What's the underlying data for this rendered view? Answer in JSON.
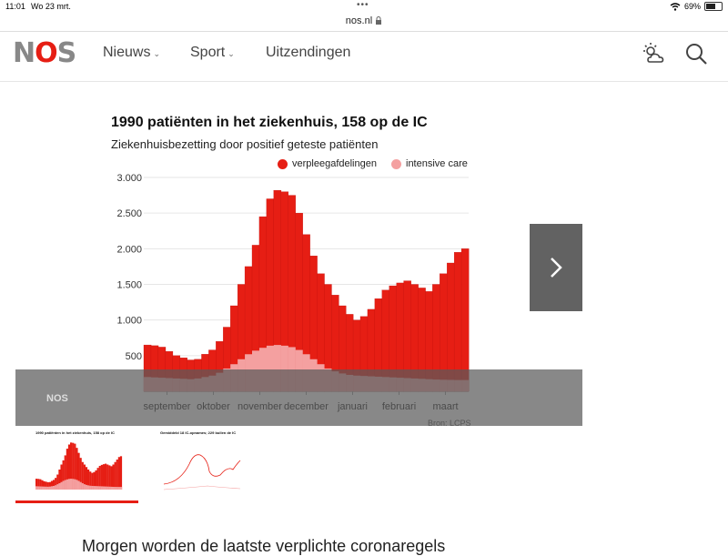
{
  "status_bar": {
    "time": "11:01",
    "date": "Wo 23 mrt.",
    "battery": "69%",
    "battery_level": 0.69
  },
  "url": "nos.nl",
  "nav": {
    "logo": "NOS",
    "items": [
      {
        "label": "Nieuws",
        "has_dropdown": true
      },
      {
        "label": "Sport",
        "has_dropdown": true
      },
      {
        "label": "Uitzendingen",
        "has_dropdown": false
      }
    ],
    "weather_icon": "weather-icon",
    "search_icon": "search-icon"
  },
  "chart_data": {
    "type": "area",
    "title": "1990 patiënten in het ziekenhuis, 158 op de IC",
    "subtitle": "Ziekenhuisbezetting door positief geteste patiënten",
    "series": [
      {
        "name": "verpleegafdelingen",
        "color": "#e61e14",
        "values": [
          650,
          640,
          620,
          560,
          500,
          470,
          440,
          450,
          520,
          580,
          700,
          900,
          1200,
          1500,
          1750,
          2050,
          2450,
          2700,
          2820,
          2800,
          2750,
          2500,
          2200,
          1900,
          1650,
          1500,
          1350,
          1200,
          1080,
          1000,
          1050,
          1150,
          1300,
          1420,
          1480,
          1520,
          1550,
          1500,
          1450,
          1400,
          1500,
          1650,
          1800,
          1950,
          2000
        ]
      },
      {
        "name": "intensive care",
        "color": "#f4a0a0",
        "values": [
          200,
          195,
          190,
          185,
          180,
          175,
          170,
          180,
          200,
          220,
          260,
          320,
          380,
          450,
          520,
          570,
          610,
          640,
          650,
          640,
          620,
          580,
          520,
          450,
          380,
          320,
          280,
          250,
          230,
          220,
          215,
          210,
          205,
          200,
          195,
          190,
          185,
          180,
          175,
          170,
          165,
          162,
          160,
          158,
          158
        ]
      }
    ],
    "x_labels": [
      "september",
      "oktober",
      "november",
      "december",
      "januari",
      "februari",
      "maart"
    ],
    "y_ticks": [
      "500",
      "1.000",
      "1.500",
      "2.000",
      "2.500",
      "3.000"
    ],
    "ylim": [
      0,
      3000
    ],
    "legend_position": "top-right",
    "grid": true,
    "source": "Bron: LCPS"
  },
  "overlay_label": "NOS",
  "thumbnails": [
    {
      "title": "1990 patiënten in het ziekenhuis, 158 op de IC",
      "active": true
    },
    {
      "title": "Gemiddeld 18 IC-opnames; 229 bullen de IC",
      "active": false
    }
  ],
  "article_lead": "Morgen worden de laatste verplichte coronaregels"
}
